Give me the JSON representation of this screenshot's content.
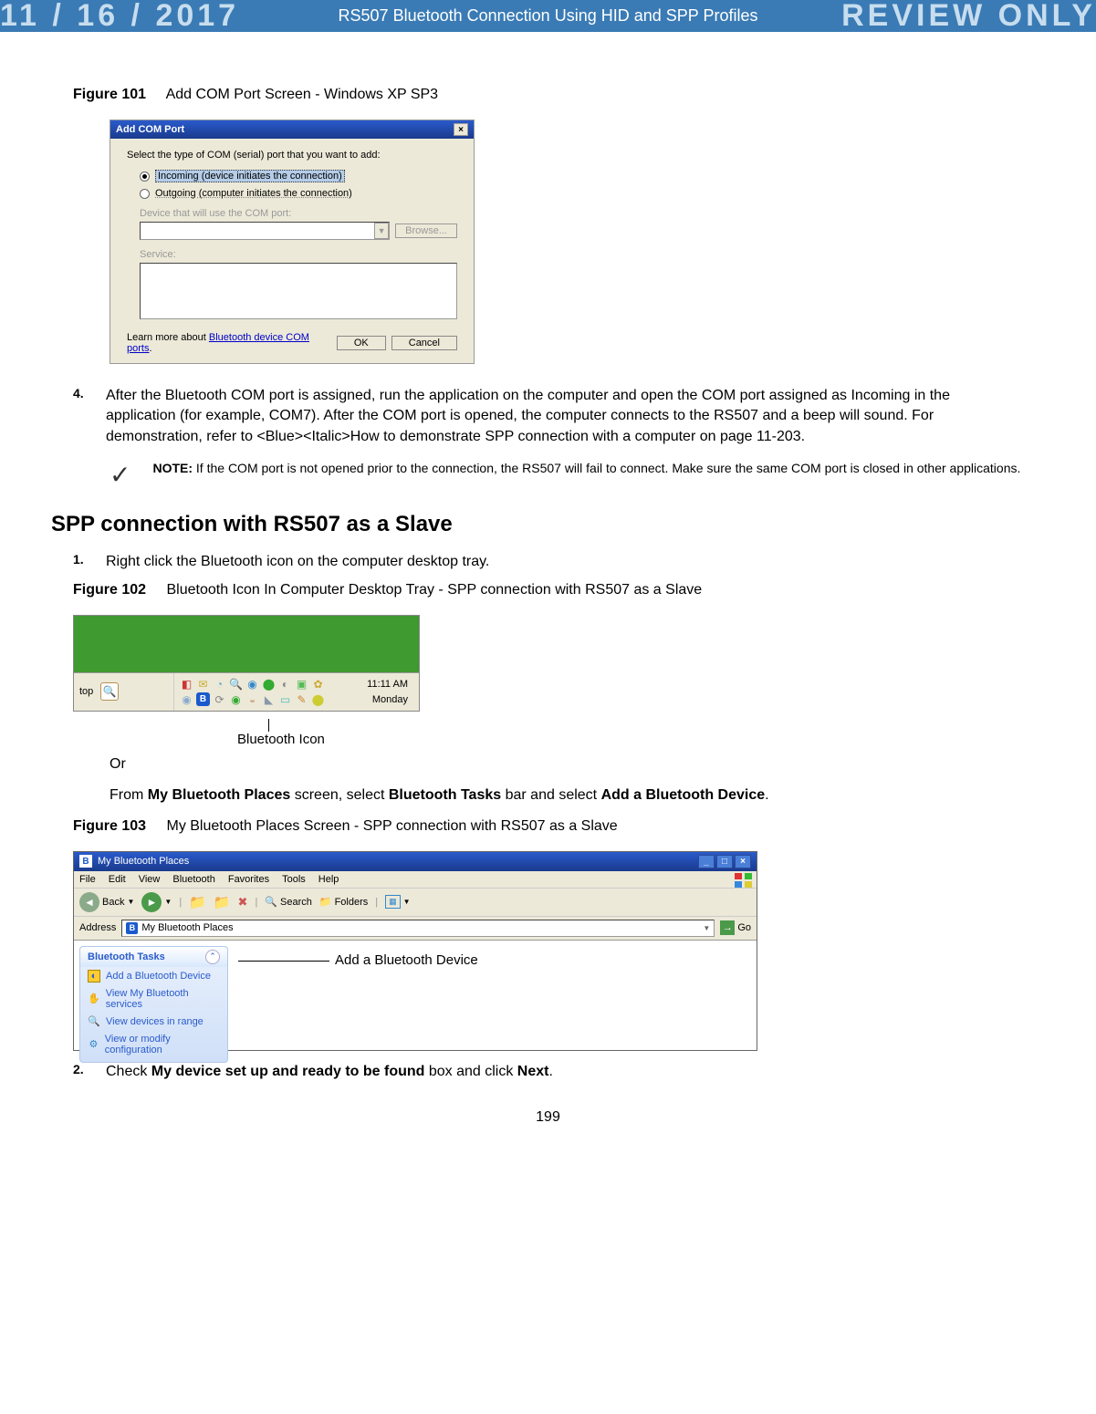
{
  "watermark": {
    "date": "11 / 16 / 2017",
    "notice": "REVIEW ONLY"
  },
  "header": {
    "title": "RS507 Bluetooth Connection Using HID and SPP Profiles"
  },
  "figure101": {
    "label": "Figure 101",
    "caption": "Add COM Port Screen - Windows XP SP3",
    "dialog": {
      "title": "Add COM Port",
      "close": "×",
      "prompt": "Select the type of COM (serial) port that you want to add:",
      "radio_incoming": "Incoming (device initiates the connection)",
      "radio_outgoing": "Outgoing (computer initiates the connection)",
      "device_label": "Device that will use the COM port:",
      "browse": "Browse...",
      "service_label": "Service:",
      "learn_prefix": "Learn more about ",
      "learn_link": "Bluetooth device COM ports",
      "learn_suffix": ".",
      "ok": "OK",
      "cancel": "Cancel"
    }
  },
  "step4": {
    "num": "4.",
    "text": "After the Bluetooth COM port is assigned, run the application on the computer and open the COM port assigned as Incoming in the application (for example, COM7). After the COM port is opened, the computer connects to the RS507 and a beep will sound. For demonstration, refer to <Blue><Italic>How to demonstrate SPP connection with a computer on page 11-203."
  },
  "note": {
    "label": "NOTE:",
    "text": "If the COM port is not opened prior to the connection, the RS507 will fail to connect. Make sure the same COM port is closed in other applications."
  },
  "section": {
    "heading": "SPP connection with RS507 as a Slave"
  },
  "step1": {
    "num": "1.",
    "text": "Right click the Bluetooth icon on the computer desktop tray."
  },
  "figure102": {
    "label": "Figure 102",
    "caption": "Bluetooth Icon In Computer Desktop Tray - SPP connection with RS507 as a Slave",
    "tray": {
      "tab_text": "top",
      "time": "11:11 AM",
      "day": "Monday"
    },
    "callout": "Bluetooth Icon"
  },
  "or_text": "Or",
  "from_text_pre": "From ",
  "from_text_b1": "My Bluetooth Places",
  "from_text_mid": " screen, select ",
  "from_text_b2": "Bluetooth Tasks",
  "from_text_mid2": " bar and select ",
  "from_text_b3": "Add a Bluetooth Device",
  "from_text_post": ".",
  "figure103": {
    "label": "Figure 103",
    "caption": "My Bluetooth Places Screen - SPP connection with RS507 as a Slave",
    "explorer": {
      "title": "My Bluetooth Places",
      "menu": [
        "File",
        "Edit",
        "View",
        "Bluetooth",
        "Favorites",
        "Tools",
        "Help"
      ],
      "back": "Back",
      "search": "Search",
      "folders": "Folders",
      "addr_label": "Address",
      "addr_value": "My Bluetooth Places",
      "go": "Go",
      "panel_title": "Bluetooth Tasks",
      "tasks": [
        "Add a Bluetooth Device",
        "View My Bluetooth services",
        "View devices in range",
        "View or modify configuration"
      ]
    },
    "callout": "Add a Bluetooth Device"
  },
  "step2": {
    "num": "2.",
    "text_pre": "Check ",
    "text_b": "My device set up and ready to be found",
    "text_mid": " box and click ",
    "text_b2": "Next",
    "text_post": "."
  },
  "page_num": "199"
}
